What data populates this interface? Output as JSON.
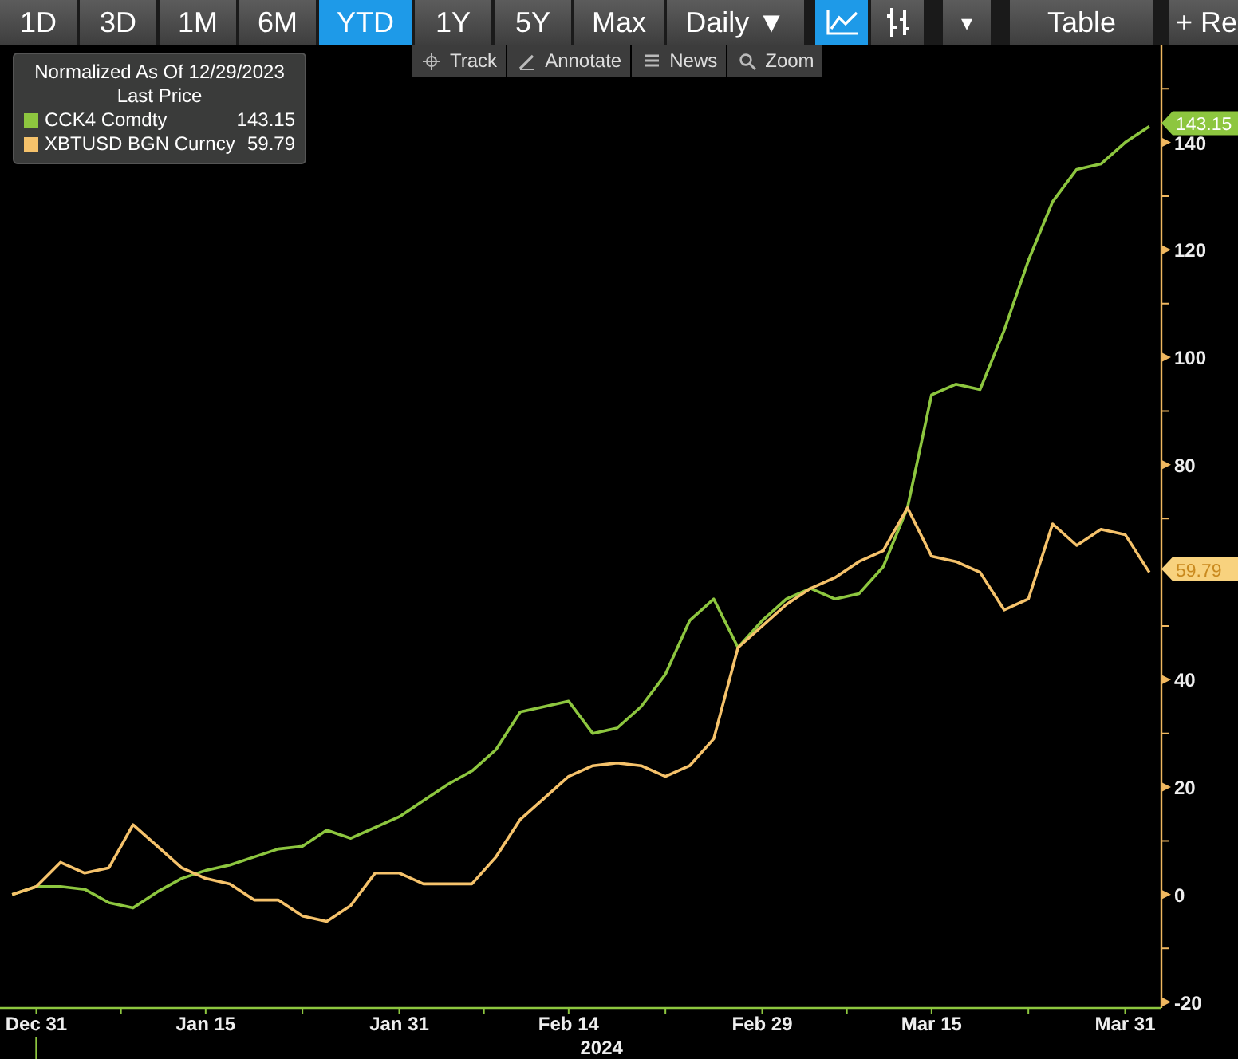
{
  "toolbar": [
    {
      "kind": "button",
      "label": "1D",
      "selected": false
    },
    {
      "kind": "button",
      "label": "3D",
      "selected": false
    },
    {
      "kind": "button",
      "label": "1M",
      "selected": false
    },
    {
      "kind": "button",
      "label": "6M",
      "selected": false
    },
    {
      "kind": "button",
      "label": "YTD",
      "selected": true
    },
    {
      "kind": "button",
      "label": "1Y",
      "selected": false
    },
    {
      "kind": "button",
      "label": "5Y",
      "selected": false
    },
    {
      "kind": "button",
      "label": "Max",
      "selected": false
    },
    {
      "kind": "dropdown",
      "label": "Daily ▼",
      "selected": false
    },
    {
      "kind": "line-chart",
      "selected": true
    },
    {
      "kind": "bar-chart",
      "selected": false
    },
    {
      "kind": "caret",
      "label": "▾",
      "selected": false
    },
    {
      "kind": "button",
      "label": "Table",
      "selected": false
    },
    {
      "kind": "button",
      "label": "+ Re",
      "selected": false
    }
  ],
  "tools": [
    {
      "label": "Track"
    },
    {
      "label": "Annotate"
    },
    {
      "label": "News"
    },
    {
      "label": "Zoom"
    }
  ],
  "legend": {
    "title": "Normalized As Of 12/29/2023",
    "subtitle": "Last Price",
    "values": [
      "143.15",
      "59.79"
    ]
  },
  "chart_data": {
    "type": "line",
    "xlabel": "2024",
    "categories": [
      null,
      "Dec 31",
      null,
      null,
      null,
      null,
      null,
      null,
      "Jan 15",
      null,
      null,
      null,
      null,
      null,
      null,
      null,
      "Jan 31",
      null,
      null,
      null,
      null,
      null,
      null,
      "Feb 14",
      null,
      null,
      null,
      null,
      null,
      null,
      null,
      "Feb 29",
      null,
      null,
      null,
      null,
      null,
      null,
      "Mar 15",
      null,
      null,
      null,
      null,
      null,
      null,
      null,
      "Mar 31",
      null
    ],
    "series": [
      {
        "name": "CCK4 Comdty",
        "color": "#8dc63f",
        "values": [
          0,
          1.5,
          1.5,
          1,
          -1.5,
          -2.5,
          0.5,
          3,
          4.5,
          5.5,
          7,
          8.5,
          9,
          12,
          10.5,
          12.5,
          14.5,
          17.5,
          20.5,
          23,
          27,
          34,
          35,
          36,
          30,
          31,
          35,
          41,
          51,
          55,
          46,
          51,
          55,
          57,
          55,
          56,
          61,
          72,
          93,
          95,
          94,
          105,
          118,
          129,
          135,
          136,
          140,
          143
        ]
      },
      {
        "name": "XBTUSD BGN Curncy",
        "color": "#f5c26b",
        "values": [
          0,
          1.5,
          6,
          4,
          5,
          13,
          9,
          5,
          3,
          2,
          -1,
          -1,
          -4,
          -5,
          -2,
          4,
          4,
          2,
          2,
          2,
          7,
          14,
          18,
          22,
          24,
          24.5,
          24,
          22,
          24,
          29,
          46,
          50,
          54,
          57,
          59,
          62,
          64,
          72,
          63,
          62,
          60,
          53,
          55,
          69,
          65,
          68,
          67,
          60
        ]
      }
    ],
    "legend": "upper left",
    "ylim": [
      -21.1,
      158.2
    ],
    "yticks": [
      -20,
      0,
      20,
      40,
      80,
      100,
      120,
      140
    ],
    "annotations": [
      "143.15",
      "59.79"
    ]
  }
}
